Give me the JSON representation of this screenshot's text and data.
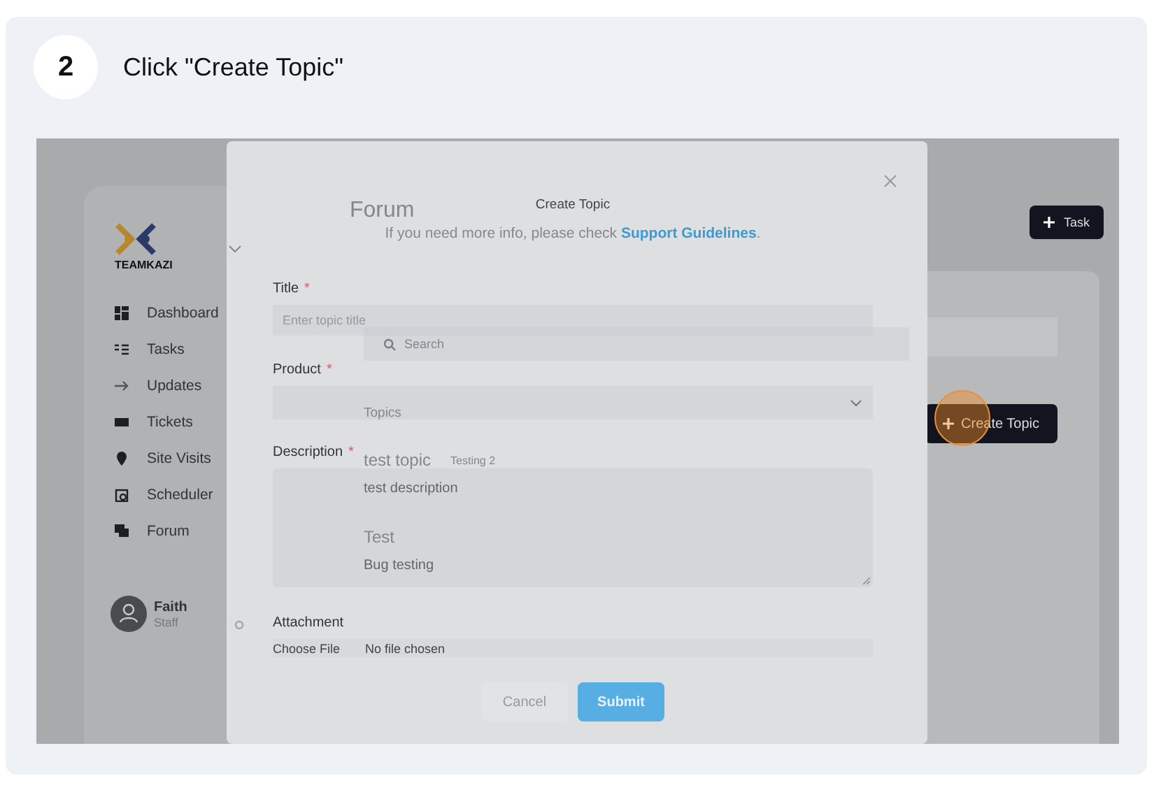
{
  "step": {
    "number": "2",
    "instruction": "Click \"Create Topic\""
  },
  "sidebar": {
    "logo_text": "TEAMKAZI",
    "items": [
      {
        "label": "Dashboard"
      },
      {
        "label": "Tasks"
      },
      {
        "label": "Updates"
      },
      {
        "label": "Tickets"
      },
      {
        "label": "Site Visits"
      },
      {
        "label": "Scheduler"
      },
      {
        "label": "Forum"
      }
    ],
    "user": {
      "name": "Faith",
      "role": "Staff"
    }
  },
  "page": {
    "title": "Forum",
    "task_button": "Task",
    "search": {
      "placeholder": "Search"
    },
    "section_label": "Topics",
    "create_button": "Create Topic",
    "topics": [
      {
        "title": "test topic",
        "tag": "Testing 2",
        "description": "test description"
      },
      {
        "title": "Test",
        "description": "Bug testing"
      }
    ]
  },
  "modal": {
    "title": "Create Topic",
    "info": "If you need more info, please check ",
    "info_link": "Support Guidelines",
    "info_end": ".",
    "fields": [
      {
        "kind": "text",
        "label": "Title",
        "required_mark": "*",
        "placeholder": "Enter topic title"
      },
      {
        "kind": "select",
        "label": "Product",
        "required_mark": "*"
      },
      {
        "kind": "textarea",
        "label": "Description",
        "required_mark": "*"
      },
      {
        "kind": "file",
        "label": "Attachment",
        "button": "Choose File",
        "value": "No file chosen"
      }
    ],
    "buttons": [
      {
        "label": "Cancel",
        "kind": "secondary"
      },
      {
        "label": "Submit",
        "kind": "primary"
      }
    ]
  }
}
